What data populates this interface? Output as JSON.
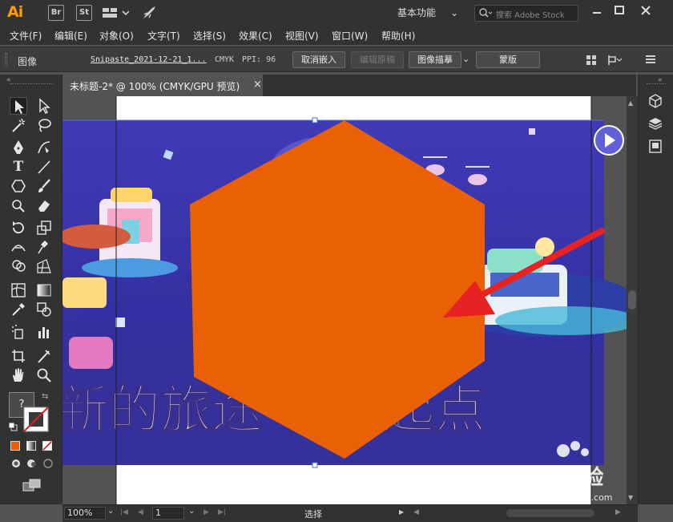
{
  "app": {
    "logo": "Ai",
    "bridge_label": "Br",
    "stock_label": "St",
    "workspace": "基本功能",
    "search_placeholder": "搜索 Adobe Stock"
  },
  "menu": [
    "文件(F)",
    "编辑(E)",
    "对象(O)",
    "文字(T)",
    "选择(S)",
    "效果(C)",
    "视图(V)",
    "窗口(W)",
    "帮助(H)"
  ],
  "control": {
    "object_type": "图像",
    "filename": "Snipaste_2021-12-21_1...",
    "colormode": "CMYK",
    "ppi": "PPI: 96",
    "unembed": "取消嵌入",
    "edit_original": "编辑原稿",
    "image_trace": "图像描摹",
    "preset": "蒙版"
  },
  "document": {
    "tab_title": "未标题-2* @ 100% (CMYK/GPU 预览)",
    "tab_close": "×"
  },
  "canvas": {
    "headline": "新的旅途 新的起点",
    "hexagon_color": "#ea6105",
    "arrow_color": "#e62222",
    "banner_color": "#3b38a8"
  },
  "toolbar": {
    "unknown_fill": "?"
  },
  "status": {
    "zoom": "100%",
    "artboard": "1",
    "tool": "选择"
  },
  "watermark": {
    "brand": "Bai 经验",
    "url": "jingyan.baidu.com"
  }
}
